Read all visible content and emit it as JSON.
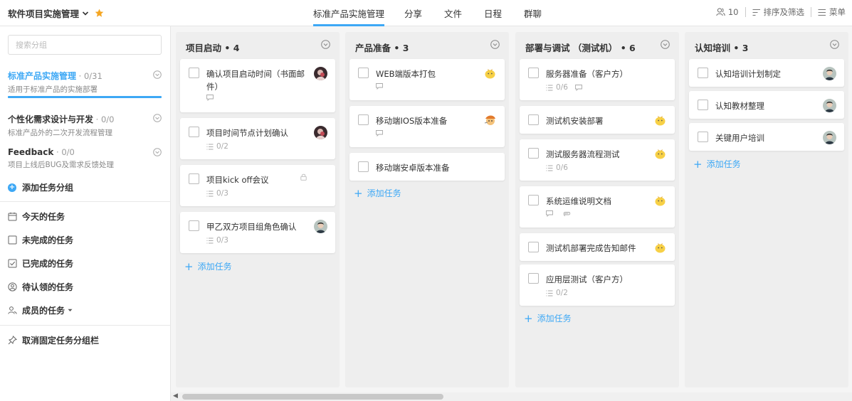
{
  "header": {
    "project_name": "软件项目实施管理",
    "tabs": [
      {
        "label": "标准产品实施管理",
        "active": true
      },
      {
        "label": "分享"
      },
      {
        "label": "文件"
      },
      {
        "label": "日程"
      },
      {
        "label": "群聊"
      }
    ],
    "members_count": "10",
    "sort_filter_label": "排序及筛选",
    "menu_label": "菜单",
    "accent_color": "#3da8f5",
    "star_color": "#f5a623"
  },
  "sidebar": {
    "search_placeholder": "搜索分组",
    "groups": [
      {
        "name": "标准产品实施管理",
        "count": " · 0/31",
        "desc": "适用于标准产品的实施部署",
        "active": true
      },
      {
        "name": "个性化需求设计与开发",
        "count": " · 0/0",
        "desc": "标准产品外的二次开发流程管理"
      },
      {
        "name": "Feedback",
        "count": " · 0/0",
        "desc": "项目上线后BUG及需求反馈处理"
      }
    ],
    "add_group_label": "添加任务分组",
    "filters": [
      {
        "label": "今天的任务",
        "icon": "calendar-icon"
      },
      {
        "label": "未完成的任务",
        "icon": "checkbox-empty-icon"
      },
      {
        "label": "已完成的任务",
        "icon": "checkbox-checked-icon"
      },
      {
        "label": "待认领的任务",
        "icon": "user-circle-icon"
      },
      {
        "label": "成员的任务",
        "icon": "users-icon"
      }
    ],
    "unpin_label": "取消固定任务分组栏"
  },
  "columns": [
    {
      "title": "项目启动 • 4",
      "tasks": [
        {
          "title": "确认项目启动时间（书面邮件）",
          "comments": true
        },
        {
          "title": "项目时间节点计划确认",
          "subtasks": "0/2"
        },
        {
          "title": "项目kick off会议",
          "subtasks": "0/3",
          "locked": true
        },
        {
          "title": "甲乙双方项目组角色确认",
          "subtasks": "0/3"
        }
      ],
      "add_label": "添加任务"
    },
    {
      "title": "产品准备 • 3",
      "tasks": [
        {
          "title": "WEB端版本打包",
          "comments": true
        },
        {
          "title": "移动端IOS版本准备",
          "comments": true
        },
        {
          "title": "移动端安卓版本准备"
        }
      ],
      "add_label": "添加任务"
    },
    {
      "title": "部署与调试 （测试机） • 6",
      "tasks": [
        {
          "title": "服务器准备（客户方）",
          "subtasks": "0/6",
          "comments": true
        },
        {
          "title": "测试机安装部署"
        },
        {
          "title": "测试服务器流程测试",
          "subtasks": "0/6"
        },
        {
          "title": "系统运维说明文档",
          "comments": true,
          "attachments": true
        },
        {
          "title": "测试机部署完成告知邮件"
        },
        {
          "title": "应用层测试（客户方）",
          "subtasks": "0/2"
        }
      ],
      "add_label": "添加任务"
    },
    {
      "title": "认知培训 • 3",
      "tasks": [
        {
          "title": "认知培训计划制定"
        },
        {
          "title": "认知教材整理"
        },
        {
          "title": "关键用户培训"
        }
      ],
      "add_label": "添加任务"
    }
  ]
}
